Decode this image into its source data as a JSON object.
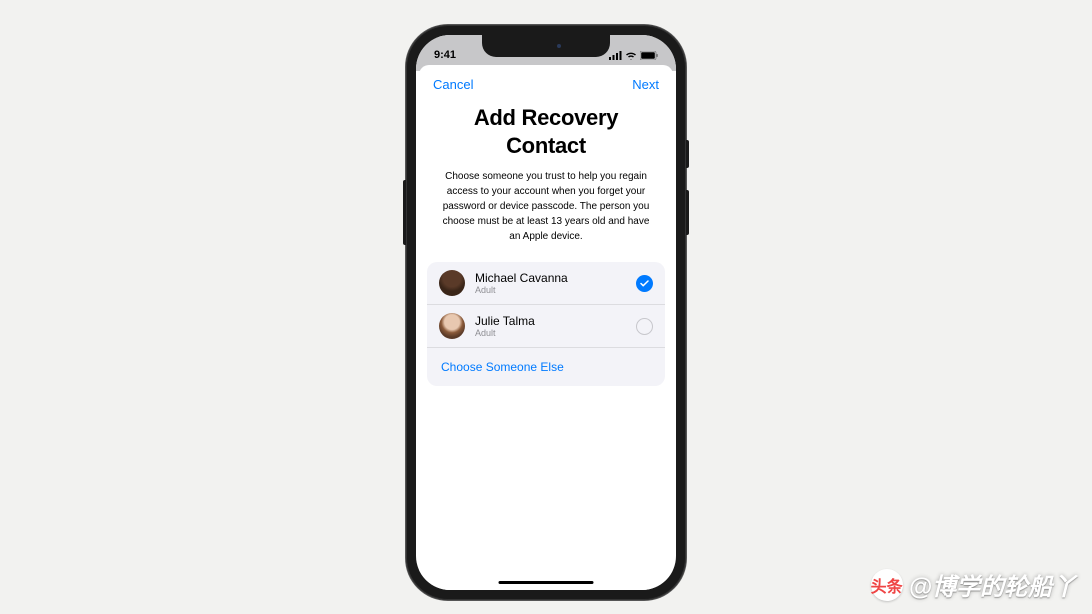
{
  "statusBar": {
    "time": "9:41"
  },
  "modal": {
    "cancelLabel": "Cancel",
    "nextLabel": "Next",
    "title": "Add Recovery Contact",
    "description": "Choose someone you trust to help you regain access to your account when you forget your password or device passcode. The person you choose must be at least 13 years old and have an Apple device."
  },
  "contacts": [
    {
      "name": "Michael Cavanna",
      "role": "Adult",
      "selected": true
    },
    {
      "name": "Julie Talma",
      "role": "Adult",
      "selected": false
    }
  ],
  "chooseElseLabel": "Choose Someone Else",
  "watermark": {
    "logoText": "头条",
    "text": "@博学的轮船丫"
  }
}
